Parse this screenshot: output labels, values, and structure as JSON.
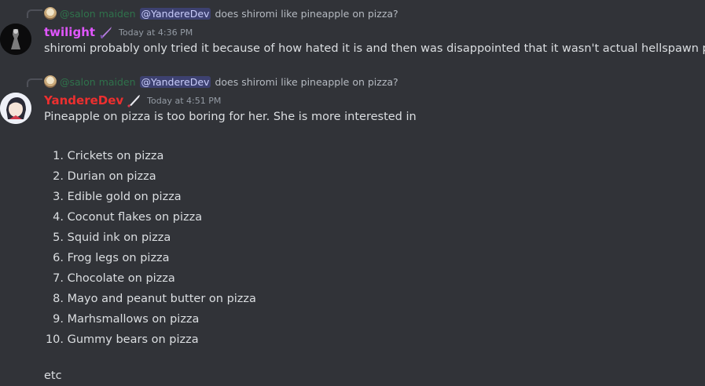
{
  "messages": [
    {
      "reply": {
        "author": "@salon maiden",
        "mention": "@YandereDev",
        "text": "does shiromi like pineapple on pizza?"
      },
      "author": "twilight",
      "timestamp": "Today at 4:36 PM",
      "text": "shiromi probably only tried it because of how hated it is and then was disappointed that it wasn't actual hellspawn pizza",
      "name_color": "#e056fd",
      "badge_icon": "sword-icon"
    },
    {
      "reply": {
        "author": "@salon maiden",
        "mention": "@YandereDev",
        "text": "does shiromi like pineapple on pizza?"
      },
      "author": "YandereDev",
      "timestamp": "Today at 4:51 PM",
      "text": "Pineapple on pizza is too boring for her. She is more interested in",
      "name_color": "#ed2f2f",
      "badge_icon": "knife-icon",
      "list": [
        {
          "num": "1.",
          "text": "Crickets on pizza"
        },
        {
          "num": "2.",
          "text": "Durian on pizza"
        },
        {
          "num": "3.",
          "text": "Edible gold on pizza"
        },
        {
          "num": "4.",
          "text": "Coconut flakes on pizza"
        },
        {
          "num": "5.",
          "text": "Squid ink on pizza"
        },
        {
          "num": "6.",
          "text": "Frog legs on pizza"
        },
        {
          "num": "7.",
          "text": "Chocolate on pizza"
        },
        {
          "num": "8.",
          "text": "Mayo and peanut butter on pizza"
        },
        {
          "num": "9.",
          "text": "Marhsmallows on pizza"
        },
        {
          "num": "10.",
          "text": "Gummy bears on pizza"
        }
      ],
      "trailer": "etc"
    }
  ]
}
